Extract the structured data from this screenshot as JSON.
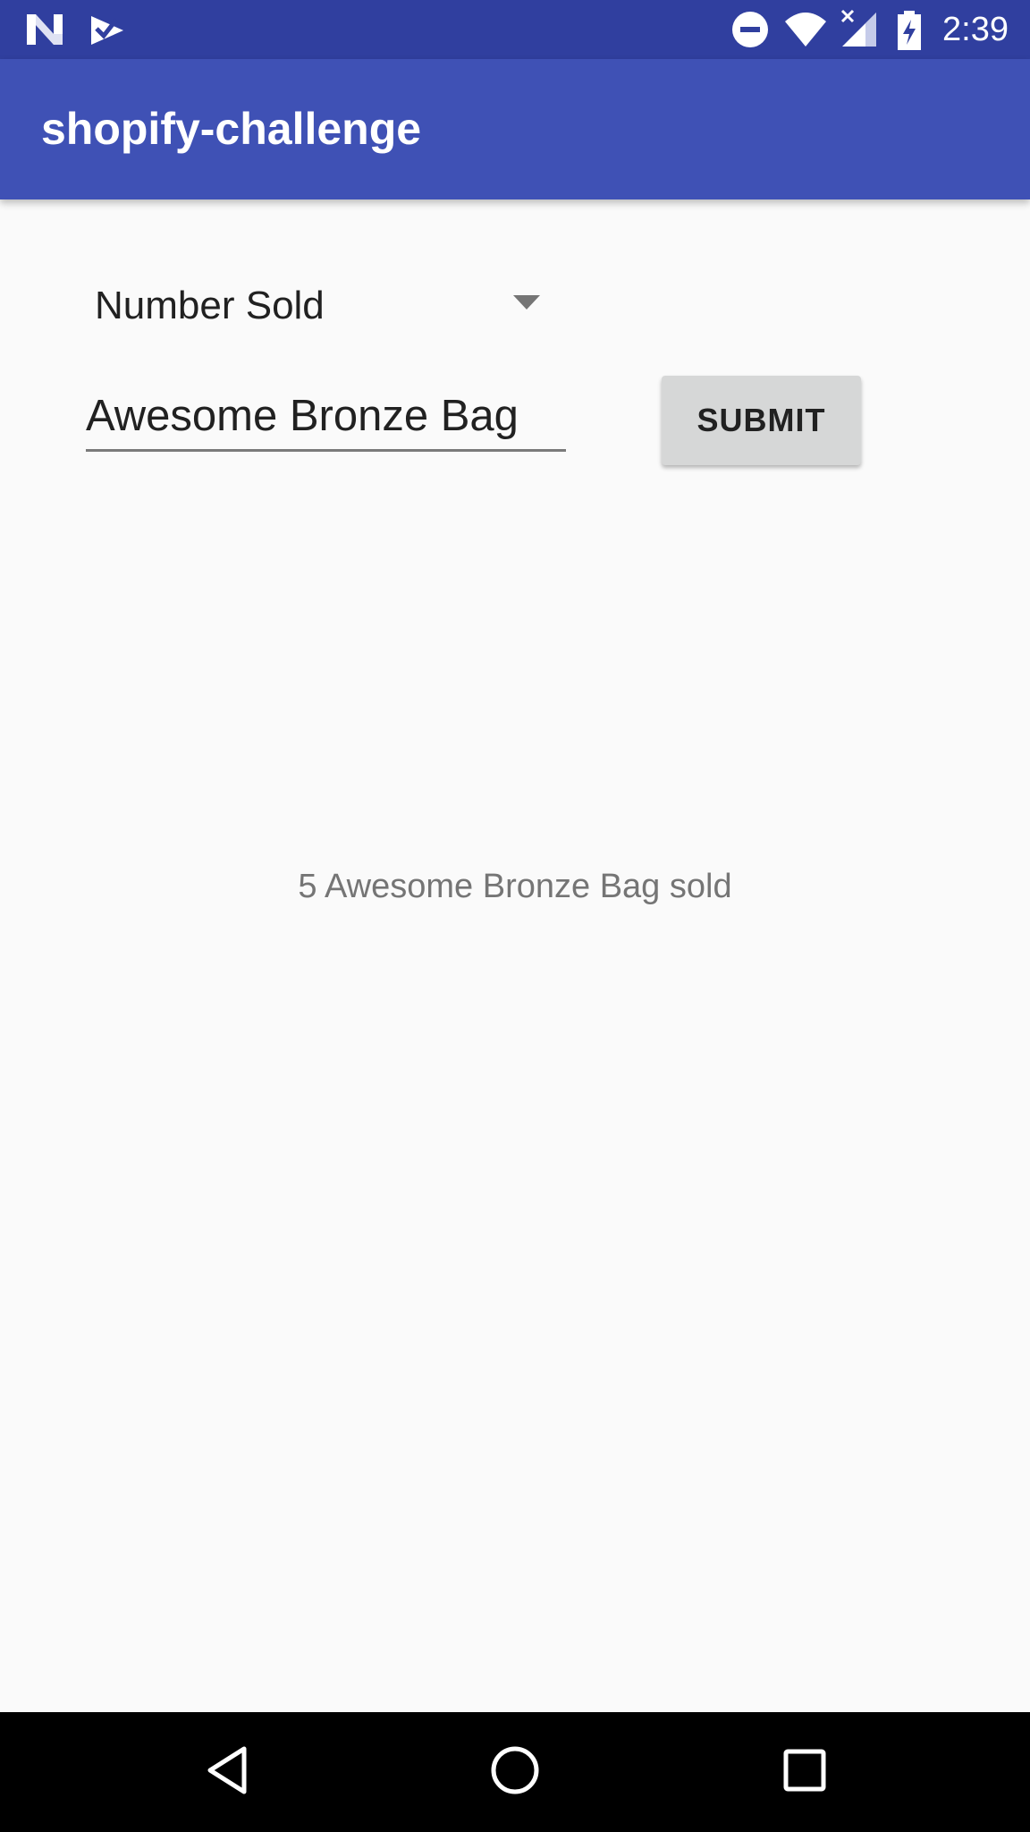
{
  "status_bar": {
    "time": "2:39",
    "icons": [
      "n-notification-icon",
      "check-notification-icon",
      "do-not-disturb-icon",
      "wifi-icon",
      "signal-icon",
      "battery-charging-icon"
    ],
    "background_color": "#303f9f"
  },
  "app_bar": {
    "title": "shopify-challenge",
    "background_color": "#3f51b5"
  },
  "form": {
    "spinner": {
      "selected_value": "Number Sold"
    },
    "product_field": {
      "value": "Awesome Bronze Bag"
    },
    "submit_label": "SUBMIT"
  },
  "result": {
    "text": "5 Awesome Bronze Bag sold"
  },
  "nav_bar": {
    "icons": [
      "back-icon",
      "home-icon",
      "recents-icon"
    ]
  }
}
